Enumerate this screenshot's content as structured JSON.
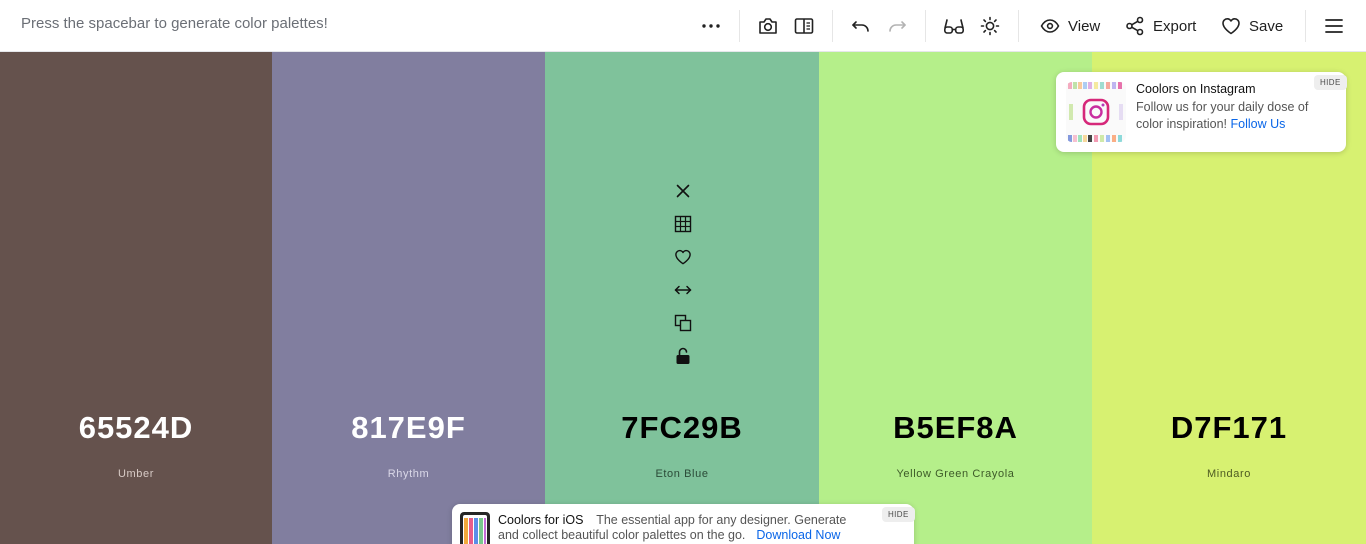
{
  "toolbar": {
    "hint": "Press the spacebar to generate color palettes!",
    "view_label": "View",
    "export_label": "Export",
    "save_label": "Save"
  },
  "palette": [
    {
      "hex": "65524D",
      "name": "Umber",
      "color": "#65524D",
      "text_color": "#ffffff",
      "name_color": "#d8cbc6"
    },
    {
      "hex": "817E9F",
      "name": "Rhythm",
      "color": "#817E9F",
      "text_color": "#ffffff",
      "name_color": "#dad8e8"
    },
    {
      "hex": "7FC29B",
      "name": "Eton Blue",
      "color": "#7FC29B",
      "text_color": "#000000",
      "name_color": "#2a4a37"
    },
    {
      "hex": "B5EF8A",
      "name": "Yellow Green Crayola",
      "color": "#B5EF8A",
      "text_color": "#000000",
      "name_color": "#3d5a28"
    },
    {
      "hex": "D7F171",
      "name": "Mindaro",
      "color": "#D7F171",
      "text_color": "#000000",
      "name_color": "#4e5a22"
    }
  ],
  "instagram_popup": {
    "title": "Coolors on Instagram",
    "body": "Follow us for your daily dose of color inspiration!",
    "link": "Follow Us",
    "hide": "HIDE"
  },
  "ios_popup": {
    "title": "Coolors for iOS",
    "body_line1": "The essential app for any designer. Generate",
    "body_line2": "and collect beautiful color palettes on the go.",
    "link": "Download Now",
    "hide": "HIDE"
  }
}
